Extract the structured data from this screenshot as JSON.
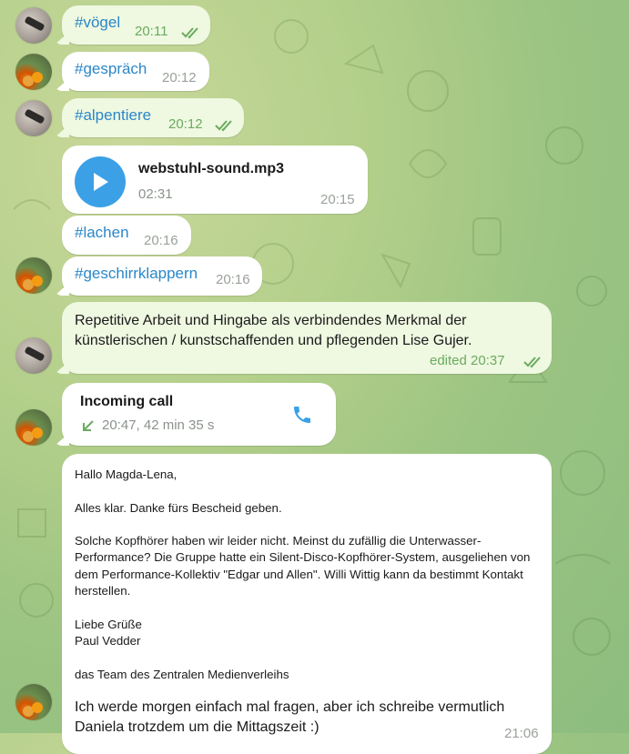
{
  "messages": [
    {
      "type": "hashtag",
      "text": "#vögel",
      "time": "20:11",
      "outgoing": true
    },
    {
      "type": "hashtag",
      "text": "#gespräch",
      "time": "20:12",
      "outgoing": false
    },
    {
      "type": "hashtag",
      "text": "#alpentiere",
      "time": "20:12",
      "outgoing": true
    },
    {
      "type": "audio",
      "file_name": "webstuhl-sound.mp3",
      "duration": "02:31",
      "time": "20:15"
    },
    {
      "type": "hashtag",
      "text": "#lachen",
      "time": "20:16",
      "outgoing": false
    },
    {
      "type": "hashtag",
      "text": "#geschirrklappern",
      "time": "20:16",
      "outgoing": false
    },
    {
      "type": "text",
      "text": "Repetitive Arbeit und Hingabe als verbindendes Merkmal der künstlerischen / kunstschaffenden und pflegenden Lise Gujer.",
      "time": "edited 20:37",
      "outgoing": true
    },
    {
      "type": "call",
      "title": "Incoming call",
      "detail": "20:47, 42 min 35 s"
    },
    {
      "type": "email",
      "greeting": "Hallo Magda-Lena,",
      "line1": "Alles klar. Danke fürs Bescheid geben.",
      "para": "Solche Kopfhörer haben wir leider nicht. Meinst du zufällig die Unterwasser-Performance? Die Gruppe hatte ein Silent-Disco-Kopfhörer-System, ausgeliehen von dem Performance-Kollektiv \"Edgar und Allen\". Willi Wittig kann da bestimmt Kontakt herstellen.",
      "closing1": "Liebe Grüße",
      "closing2": "Paul Vedder",
      "team": "das Team des Zentralen Medienverleihs",
      "reply": "Ich werde morgen einfach mal fragen, aber ich schreibe vermutlich Daniela trotzdem um die Mittagszeit :)",
      "time": "21:06"
    }
  ],
  "colors": {
    "outgoing_bubble": "#eff8e1",
    "incoming_bubble": "#ffffff",
    "link": "#2a87c9",
    "accent": "#3ba0e6",
    "check": "#6aab5f"
  }
}
